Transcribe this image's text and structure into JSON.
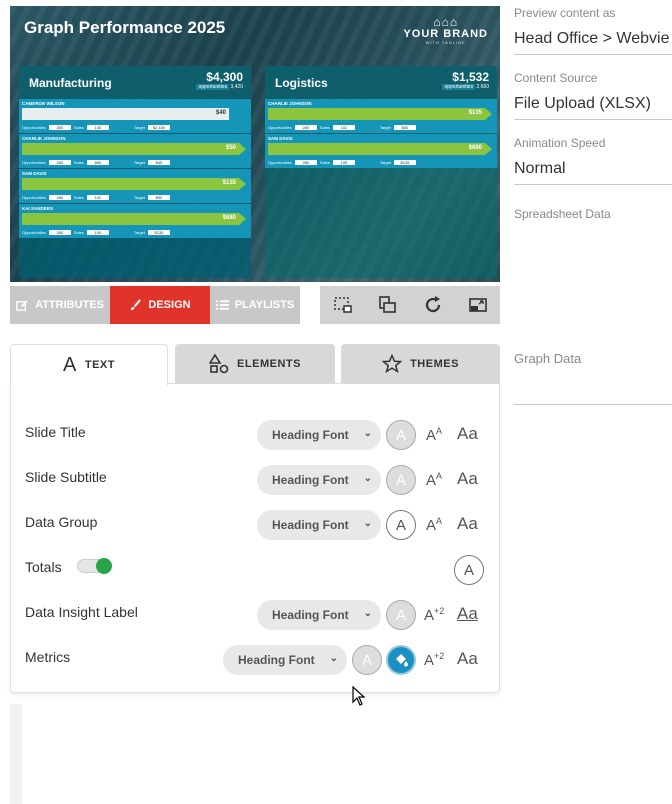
{
  "preview": {
    "title": "Graph Performance 2025",
    "brand": {
      "name": "YOUR BRAND",
      "tagline": "WITH TAGLINE"
    },
    "groups": [
      {
        "name": "Manufacturing",
        "total": "$4,300",
        "opportunities_label": "opportunities",
        "opportunities": "3,420",
        "rows": [
          {
            "name": "CAMERON WILSON",
            "amount": "$40",
            "opp": "280",
            "sales": "135",
            "target": "$2,450",
            "bar_fill": 0.95,
            "bar_style": "white"
          },
          {
            "name": "CHARLIE JOHNSON",
            "amount": "$50",
            "opp": "280",
            "sales": "850",
            "target": "$40",
            "bar_fill": 1.0,
            "bar_style": "green"
          },
          {
            "name": "SAM DAVIS",
            "amount": "$135",
            "opp": "280",
            "sales": "102",
            "target": "$50",
            "bar_fill": 1.0,
            "bar_style": "green"
          },
          {
            "name": "KAI SANDERS",
            "amount": "$680",
            "opp": "280",
            "sales": "105",
            "target": "$135",
            "bar_fill": 1.0,
            "bar_style": "green"
          }
        ]
      },
      {
        "name": "Logistics",
        "total": "$1,532",
        "opportunities_label": "opportunities",
        "opportunities": "2,660",
        "rows": [
          {
            "name": "CHARLIE JOHNSON",
            "amount": "$135",
            "opp": "280",
            "sales": "102",
            "target": "$50",
            "bar_fill": 1.0,
            "bar_style": "green"
          },
          {
            "name": "SAM DAVIS",
            "amount": "$680",
            "opp": "280",
            "sales": "105",
            "target": "$135",
            "bar_fill": 1.0,
            "bar_style": "green"
          }
        ]
      }
    ],
    "labels": {
      "opportunities": "Opportunities",
      "sales": "Sales",
      "target": "Target"
    }
  },
  "modes": {
    "attributes": "ATTRIBUTES",
    "design": "DESIGN",
    "playlists": "PLAYLISTS"
  },
  "toolbar": {
    "icons": [
      "crop-screenshot-icon",
      "layers-icon",
      "refresh-icon",
      "resize-icon"
    ]
  },
  "panel_tabs": {
    "text": "TEXT",
    "elements": "ELEMENTS",
    "themes": "THEMES"
  },
  "text_rows": [
    {
      "label": "Slide Title",
      "font": "Heading Font"
    },
    {
      "label": "Slide Subtitle",
      "font": "Heading Font"
    },
    {
      "label": "Data Group",
      "font": "Heading Font"
    },
    {
      "label": "Totals",
      "toggle_on": true
    },
    {
      "label": "Data Insight Label",
      "font": "Heading Font"
    },
    {
      "label": "Metrics",
      "font": "Heading Font"
    }
  ],
  "icons": {
    "a_glyph": "A",
    "case_glyph": "Aa",
    "size_glyph": "A",
    "size_sup": "A",
    "size_plus": "+2"
  },
  "right": {
    "preview_as": {
      "label": "Preview content as",
      "value": "Head Office > Webvie"
    },
    "content_source": {
      "label": "Content Source",
      "value": "File Upload (XLSX)"
    },
    "animation_speed": {
      "label": "Animation Speed",
      "value": "Normal"
    },
    "spreadsheet": {
      "label": "Spreadsheet Data"
    },
    "graph_data": {
      "label": "Graph Data"
    }
  }
}
